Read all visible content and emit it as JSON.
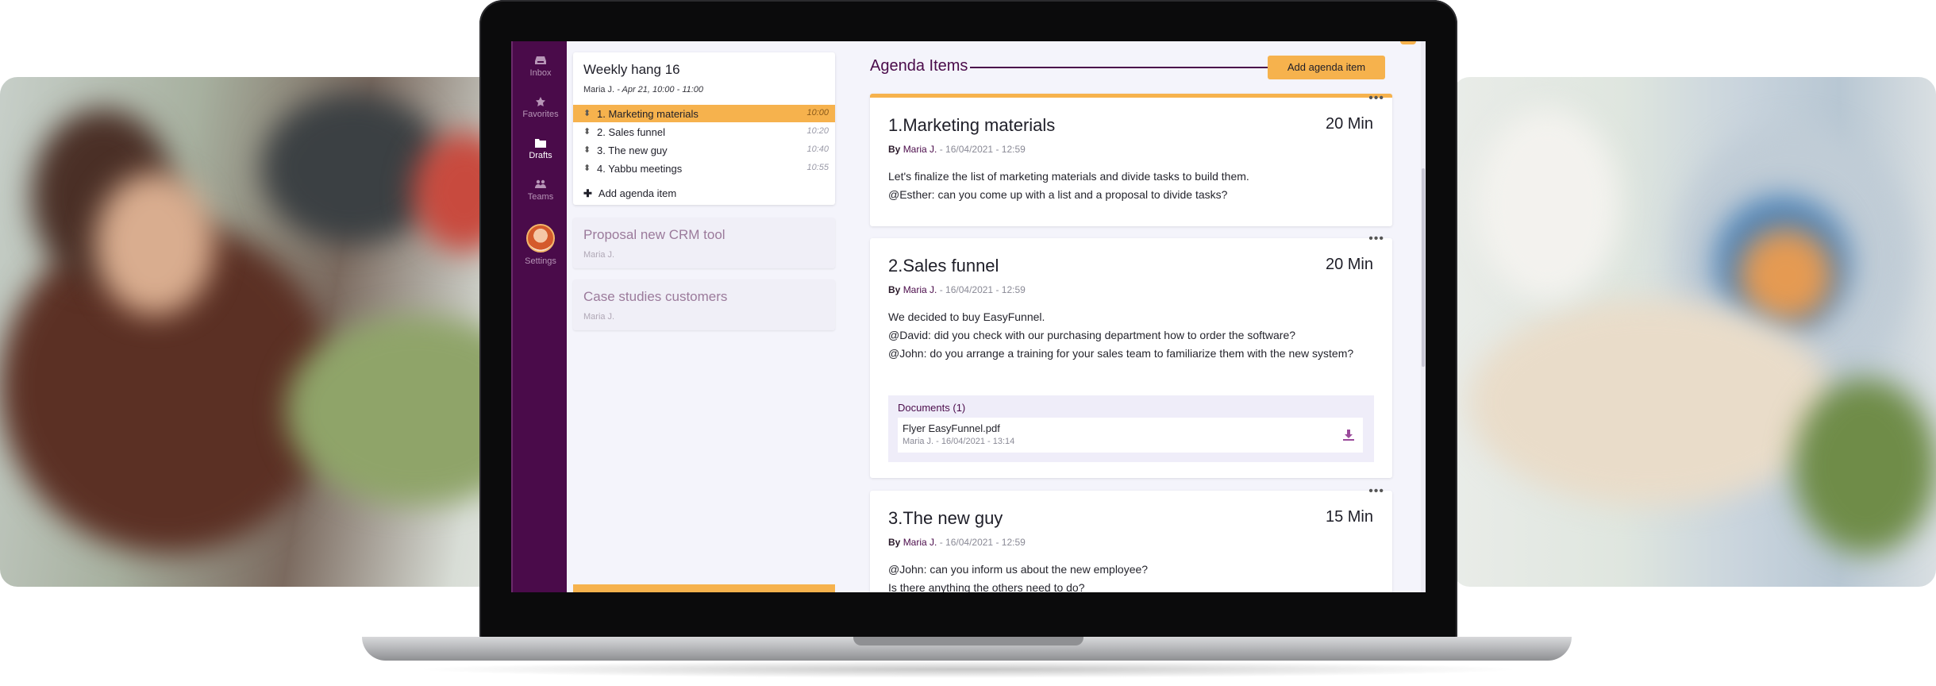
{
  "nav": {
    "inbox": "Inbox",
    "favorites": "Favorites",
    "drafts": "Drafts",
    "teams": "Teams",
    "settings": "Settings"
  },
  "meeting": {
    "title": "Weekly hang 16",
    "author": "Maria J.",
    "when": "- Apr 21, 10:00 - 11:00",
    "agenda": [
      {
        "label": "1.  Marketing materials",
        "time": "10:00"
      },
      {
        "label": "2.  Sales funnel",
        "time": "10:20"
      },
      {
        "label": "3.  The new guy",
        "time": "10:40"
      },
      {
        "label": "4.  Yabbu meetings",
        "time": "10:55"
      }
    ],
    "add_label": "Add agenda item"
  },
  "other_meetings": [
    {
      "title": "Proposal new CRM tool",
      "author": "Maria J."
    },
    {
      "title": "Case studies customers",
      "author": "Maria J."
    }
  ],
  "main": {
    "heading": "Agenda Items",
    "add_button": "Add agenda item",
    "dots": "•••",
    "items": [
      {
        "title": "1.Marketing materials",
        "minutes": "20 Min",
        "by": "By",
        "author": "Maria J.",
        "date": "-  16/04/2021 - 12:59",
        "lines": [
          "Let's finalize the list of marketing materials and divide tasks to build them.",
          "@Esther: can you come up with a list and a proposal to divide tasks?"
        ]
      },
      {
        "title": "2.Sales funnel",
        "minutes": "20 Min",
        "by": "By",
        "author": "Maria J.",
        "date": "-  16/04/2021 - 12:59",
        "lines": [
          "We decided to buy EasyFunnel.",
          "@David: did you check with our purchasing department how to order the software?",
          "@John: do you arrange a training for your sales team to familiarize them with the new system?"
        ],
        "documents": {
          "title": "Documents (1)",
          "file": "Flyer EasyFunnel.pdf",
          "meta": "Maria J. - 16/04/2021 - 13:14"
        }
      },
      {
        "title": "3.The new guy",
        "minutes": "15 Min",
        "by": "By",
        "author": "Maria J.",
        "date": "-  16/04/2021 - 12:59",
        "lines": [
          "@John: can you inform us about the new employee?",
          "Is there anything the others need to do?"
        ]
      }
    ]
  },
  "colors": {
    "brand_purple": "#4a0b4a",
    "accent_orange": "#f6b24d",
    "background": "#f4f4fb"
  },
  "icons": [
    "inbox-icon",
    "star-icon",
    "folder-icon",
    "team-icon",
    "avatar",
    "grip-icon",
    "plus-icon",
    "more-icon",
    "download-icon"
  ]
}
